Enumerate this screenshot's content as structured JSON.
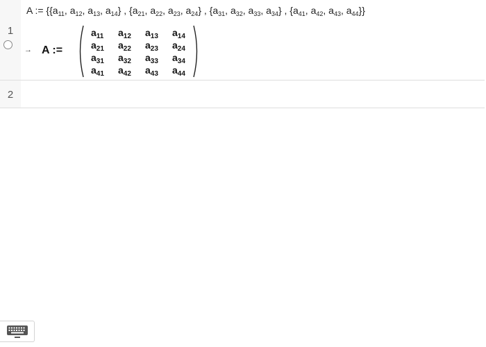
{
  "rows": [
    {
      "number": "1",
      "input": {
        "prefix": "A := {{",
        "cells": [
          {
            "base": "a",
            "sub": "11",
            "after": ", "
          },
          {
            "base": "a",
            "sub": "12",
            "after": ", "
          },
          {
            "base": "a",
            "sub": "13",
            "after": ", "
          },
          {
            "base": "a",
            "sub": "14",
            "after": "} , {"
          },
          {
            "base": "a",
            "sub": "21",
            "after": ", "
          },
          {
            "base": "a",
            "sub": "22",
            "after": ", "
          },
          {
            "base": "a",
            "sub": "23",
            "after": ", "
          },
          {
            "base": "a",
            "sub": "24",
            "after": "} , {"
          },
          {
            "base": "a",
            "sub": "31",
            "after": ", "
          },
          {
            "base": "a",
            "sub": "32",
            "after": ", "
          },
          {
            "base": "a",
            "sub": "33",
            "after": ", "
          },
          {
            "base": "a",
            "sub": "34",
            "after": "} , {"
          },
          {
            "base": "a",
            "sub": "41",
            "after": ", "
          },
          {
            "base": "a",
            "sub": "42",
            "after": ", "
          },
          {
            "base": "a",
            "sub": "43",
            "after": ", "
          },
          {
            "base": "a",
            "sub": "44",
            "after": "}}"
          }
        ]
      },
      "output": {
        "arrow": "→",
        "label": "A :=",
        "matrix": [
          [
            {
              "base": "a",
              "sub": "11"
            },
            {
              "base": "a",
              "sub": "12"
            },
            {
              "base": "a",
              "sub": "13"
            },
            {
              "base": "a",
              "sub": "14"
            }
          ],
          [
            {
              "base": "a",
              "sub": "21"
            },
            {
              "base": "a",
              "sub": "22"
            },
            {
              "base": "a",
              "sub": "23"
            },
            {
              "base": "a",
              "sub": "24"
            }
          ],
          [
            {
              "base": "a",
              "sub": "31"
            },
            {
              "base": "a",
              "sub": "32"
            },
            {
              "base": "a",
              "sub": "33"
            },
            {
              "base": "a",
              "sub": "34"
            }
          ],
          [
            {
              "base": "a",
              "sub": "41"
            },
            {
              "base": "a",
              "sub": "42"
            },
            {
              "base": "a",
              "sub": "43"
            },
            {
              "base": "a",
              "sub": "44"
            }
          ]
        ]
      }
    },
    {
      "number": "2"
    }
  ],
  "icons": {
    "row_toggle": "circle-toggle-icon",
    "keyboard": "keyboard-icon"
  }
}
